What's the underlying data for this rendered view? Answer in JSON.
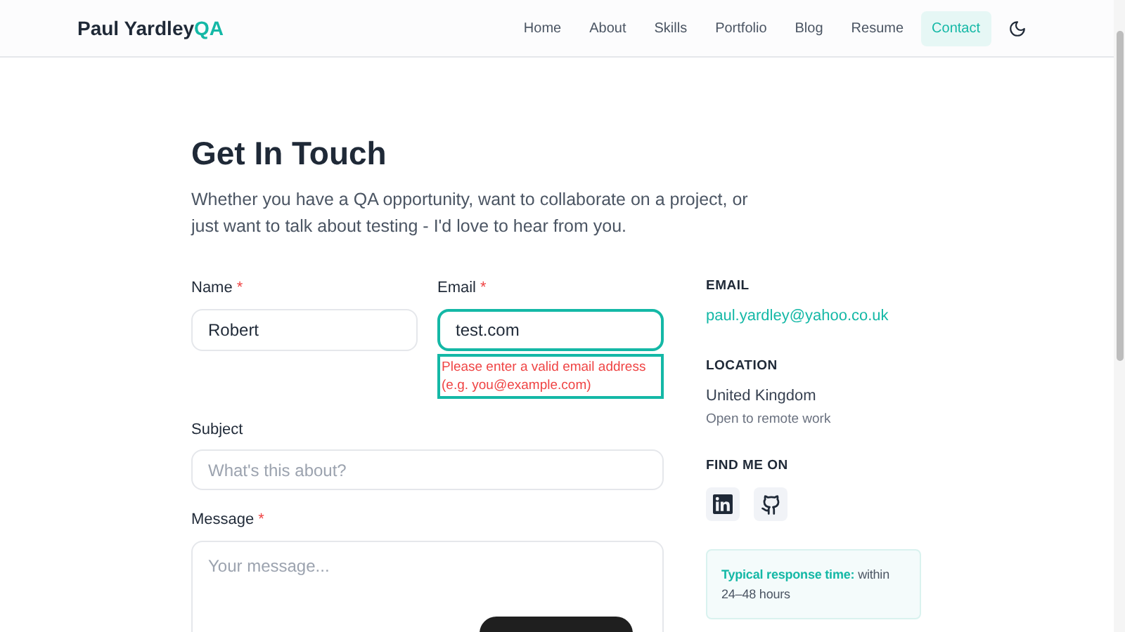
{
  "header": {
    "brand": "Paul Yardley",
    "brand_accent": "QA",
    "nav": [
      {
        "label": "Home",
        "selected": false
      },
      {
        "label": "About",
        "selected": false
      },
      {
        "label": "Skills",
        "selected": false
      },
      {
        "label": "Portfolio",
        "selected": false
      },
      {
        "label": "Blog",
        "selected": false
      },
      {
        "label": "Resume",
        "selected": false
      },
      {
        "label": "Contact",
        "selected": true
      }
    ]
  },
  "title": "Get In Touch",
  "intro": "Whether you have a QA opportunity, want to collaborate on a project, or just want to talk about testing - I'd love to hear from you.",
  "form": {
    "row": [
      {
        "label": "Name",
        "required_mark": "*",
        "value": "Robert",
        "focused": false
      },
      {
        "label": "Email",
        "required_mark": "*",
        "value": "test.com",
        "focused": true,
        "error": "Please enter a valid email address (e.g. you@example.com)"
      }
    ],
    "subject": {
      "label": "Subject",
      "placeholder": "What's this about?",
      "focused": false
    },
    "message": {
      "label": "Message",
      "required_mark": "*",
      "placeholder": "Your message...",
      "focused": false
    }
  },
  "info": {
    "email_heading": "EMAIL",
    "email": "paul.yardley@yahoo.co.uk",
    "location_heading": "LOCATION",
    "location": "United Kingdom",
    "location_note": "Open to remote work",
    "social_heading": "FIND ME ON",
    "social": [
      {
        "kind": "linkedin"
      },
      {
        "kind": "github"
      }
    ],
    "response_label": "Typical response time:",
    "response_text": "within 24–48 hours"
  }
}
